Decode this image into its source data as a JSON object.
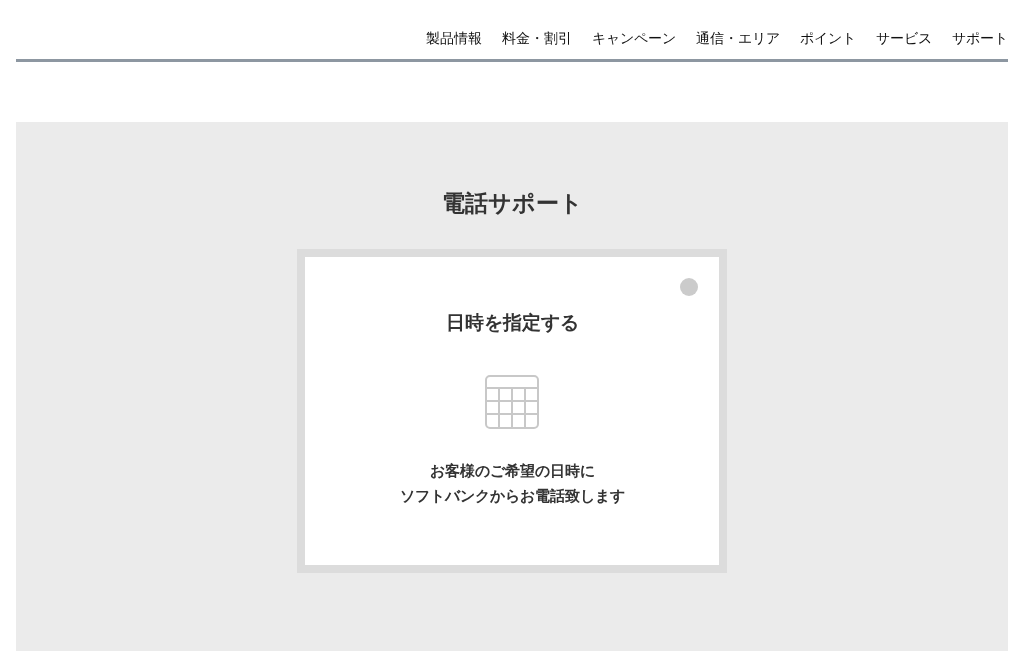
{
  "nav": {
    "items": [
      {
        "label": "製品情報"
      },
      {
        "label": "料金・割引"
      },
      {
        "label": "キャンペーン"
      },
      {
        "label": "通信・エリア"
      },
      {
        "label": "ポイント"
      },
      {
        "label": "サービス"
      },
      {
        "label": "サポート"
      }
    ]
  },
  "section": {
    "title": "電話サポート",
    "options": [
      {
        "title": "日時を指定する",
        "selected": false,
        "description_lines": [
          "お客様のご希望の日時に",
          "ソフトバンクからお電話致します"
        ]
      }
    ]
  }
}
